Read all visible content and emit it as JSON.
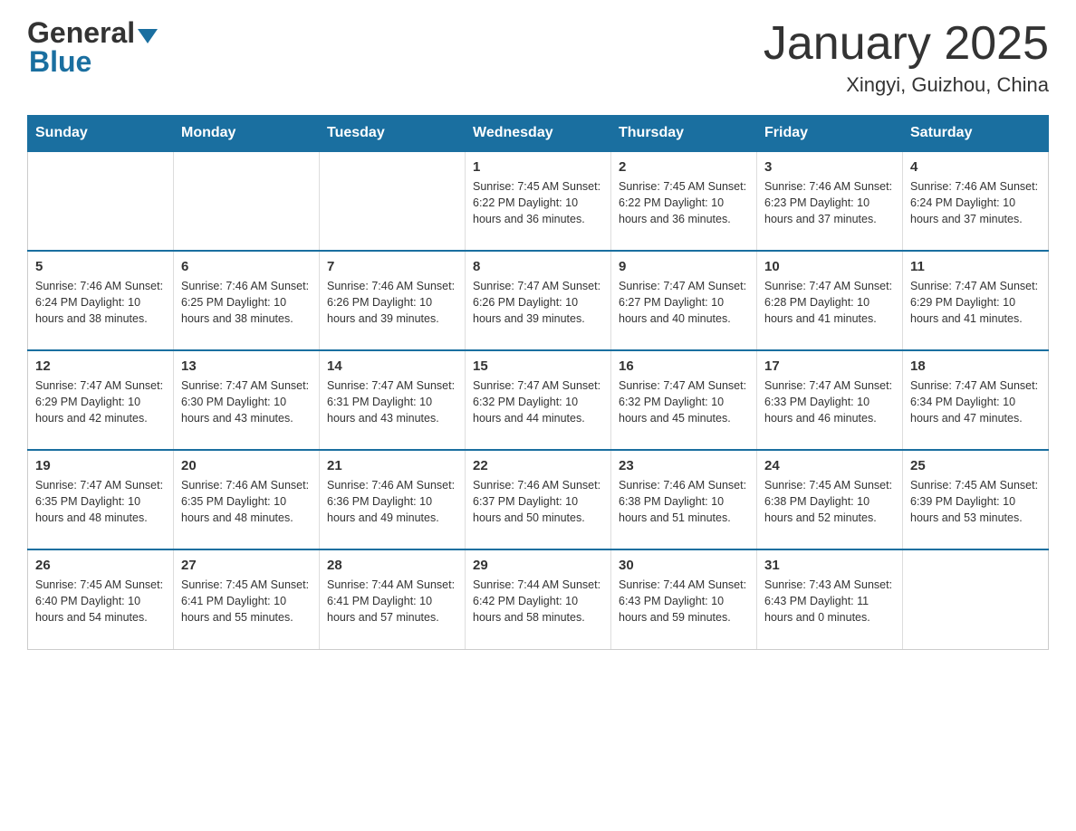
{
  "header": {
    "logo_general": "General",
    "logo_blue": "Blue",
    "title": "January 2025",
    "subtitle": "Xingyi, Guizhou, China"
  },
  "days_of_week": [
    "Sunday",
    "Monday",
    "Tuesday",
    "Wednesday",
    "Thursday",
    "Friday",
    "Saturday"
  ],
  "weeks": [
    [
      {
        "day": "",
        "info": ""
      },
      {
        "day": "",
        "info": ""
      },
      {
        "day": "",
        "info": ""
      },
      {
        "day": "1",
        "info": "Sunrise: 7:45 AM\nSunset: 6:22 PM\nDaylight: 10 hours\nand 36 minutes."
      },
      {
        "day": "2",
        "info": "Sunrise: 7:45 AM\nSunset: 6:22 PM\nDaylight: 10 hours\nand 36 minutes."
      },
      {
        "day": "3",
        "info": "Sunrise: 7:46 AM\nSunset: 6:23 PM\nDaylight: 10 hours\nand 37 minutes."
      },
      {
        "day": "4",
        "info": "Sunrise: 7:46 AM\nSunset: 6:24 PM\nDaylight: 10 hours\nand 37 minutes."
      }
    ],
    [
      {
        "day": "5",
        "info": "Sunrise: 7:46 AM\nSunset: 6:24 PM\nDaylight: 10 hours\nand 38 minutes."
      },
      {
        "day": "6",
        "info": "Sunrise: 7:46 AM\nSunset: 6:25 PM\nDaylight: 10 hours\nand 38 minutes."
      },
      {
        "day": "7",
        "info": "Sunrise: 7:46 AM\nSunset: 6:26 PM\nDaylight: 10 hours\nand 39 minutes."
      },
      {
        "day": "8",
        "info": "Sunrise: 7:47 AM\nSunset: 6:26 PM\nDaylight: 10 hours\nand 39 minutes."
      },
      {
        "day": "9",
        "info": "Sunrise: 7:47 AM\nSunset: 6:27 PM\nDaylight: 10 hours\nand 40 minutes."
      },
      {
        "day": "10",
        "info": "Sunrise: 7:47 AM\nSunset: 6:28 PM\nDaylight: 10 hours\nand 41 minutes."
      },
      {
        "day": "11",
        "info": "Sunrise: 7:47 AM\nSunset: 6:29 PM\nDaylight: 10 hours\nand 41 minutes."
      }
    ],
    [
      {
        "day": "12",
        "info": "Sunrise: 7:47 AM\nSunset: 6:29 PM\nDaylight: 10 hours\nand 42 minutes."
      },
      {
        "day": "13",
        "info": "Sunrise: 7:47 AM\nSunset: 6:30 PM\nDaylight: 10 hours\nand 43 minutes."
      },
      {
        "day": "14",
        "info": "Sunrise: 7:47 AM\nSunset: 6:31 PM\nDaylight: 10 hours\nand 43 minutes."
      },
      {
        "day": "15",
        "info": "Sunrise: 7:47 AM\nSunset: 6:32 PM\nDaylight: 10 hours\nand 44 minutes."
      },
      {
        "day": "16",
        "info": "Sunrise: 7:47 AM\nSunset: 6:32 PM\nDaylight: 10 hours\nand 45 minutes."
      },
      {
        "day": "17",
        "info": "Sunrise: 7:47 AM\nSunset: 6:33 PM\nDaylight: 10 hours\nand 46 minutes."
      },
      {
        "day": "18",
        "info": "Sunrise: 7:47 AM\nSunset: 6:34 PM\nDaylight: 10 hours\nand 47 minutes."
      }
    ],
    [
      {
        "day": "19",
        "info": "Sunrise: 7:47 AM\nSunset: 6:35 PM\nDaylight: 10 hours\nand 48 minutes."
      },
      {
        "day": "20",
        "info": "Sunrise: 7:46 AM\nSunset: 6:35 PM\nDaylight: 10 hours\nand 48 minutes."
      },
      {
        "day": "21",
        "info": "Sunrise: 7:46 AM\nSunset: 6:36 PM\nDaylight: 10 hours\nand 49 minutes."
      },
      {
        "day": "22",
        "info": "Sunrise: 7:46 AM\nSunset: 6:37 PM\nDaylight: 10 hours\nand 50 minutes."
      },
      {
        "day": "23",
        "info": "Sunrise: 7:46 AM\nSunset: 6:38 PM\nDaylight: 10 hours\nand 51 minutes."
      },
      {
        "day": "24",
        "info": "Sunrise: 7:45 AM\nSunset: 6:38 PM\nDaylight: 10 hours\nand 52 minutes."
      },
      {
        "day": "25",
        "info": "Sunrise: 7:45 AM\nSunset: 6:39 PM\nDaylight: 10 hours\nand 53 minutes."
      }
    ],
    [
      {
        "day": "26",
        "info": "Sunrise: 7:45 AM\nSunset: 6:40 PM\nDaylight: 10 hours\nand 54 minutes."
      },
      {
        "day": "27",
        "info": "Sunrise: 7:45 AM\nSunset: 6:41 PM\nDaylight: 10 hours\nand 55 minutes."
      },
      {
        "day": "28",
        "info": "Sunrise: 7:44 AM\nSunset: 6:41 PM\nDaylight: 10 hours\nand 57 minutes."
      },
      {
        "day": "29",
        "info": "Sunrise: 7:44 AM\nSunset: 6:42 PM\nDaylight: 10 hours\nand 58 minutes."
      },
      {
        "day": "30",
        "info": "Sunrise: 7:44 AM\nSunset: 6:43 PM\nDaylight: 10 hours\nand 59 minutes."
      },
      {
        "day": "31",
        "info": "Sunrise: 7:43 AM\nSunset: 6:43 PM\nDaylight: 11 hours\nand 0 minutes."
      },
      {
        "day": "",
        "info": ""
      }
    ]
  ]
}
